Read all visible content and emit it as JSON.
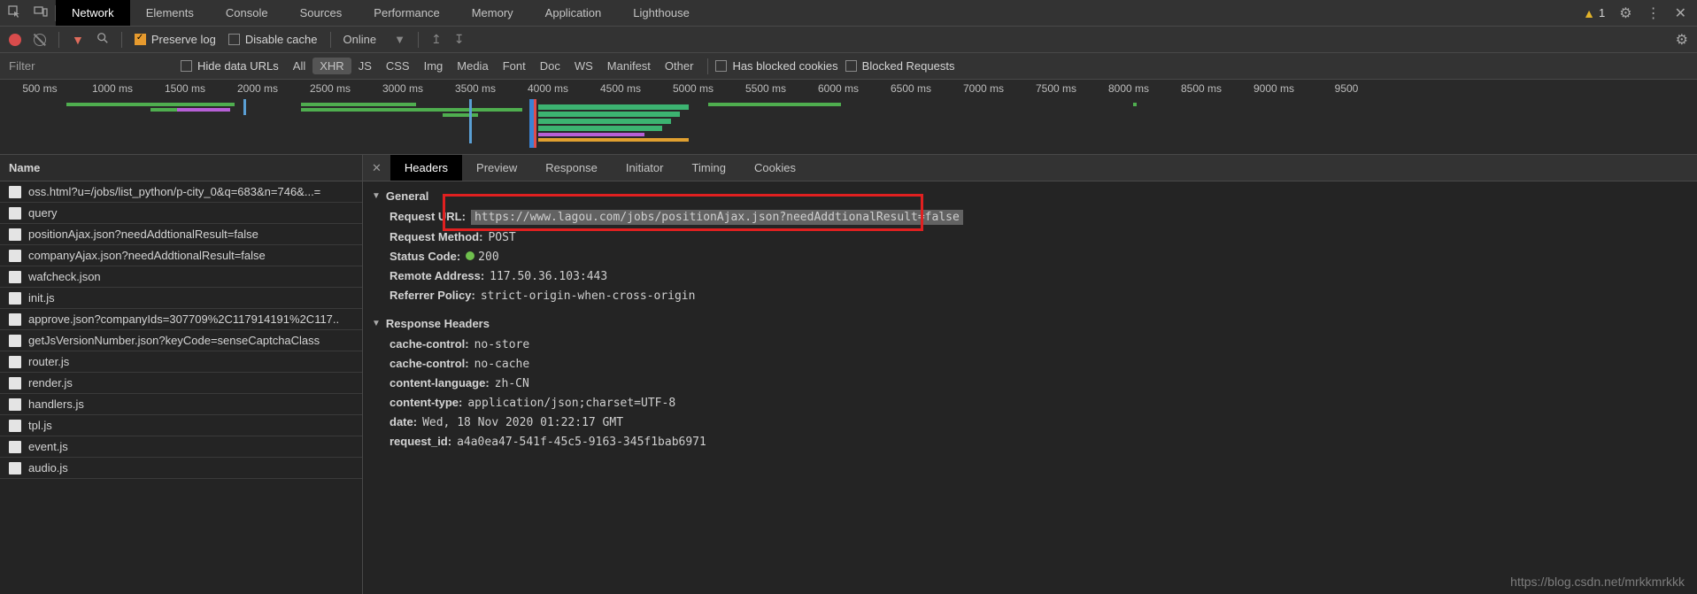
{
  "top_tabs": [
    "Network",
    "Elements",
    "Console",
    "Sources",
    "Performance",
    "Memory",
    "Application",
    "Lighthouse"
  ],
  "top_active": "Network",
  "warning_count": "1",
  "toolbar": {
    "preserve_log": "Preserve log",
    "disable_cache": "Disable cache",
    "online": "Online"
  },
  "filter": {
    "placeholder": "Filter",
    "hide_data_urls": "Hide data URLs",
    "type_filters": [
      "All",
      "XHR",
      "JS",
      "CSS",
      "Img",
      "Media",
      "Font",
      "Doc",
      "WS",
      "Manifest",
      "Other"
    ],
    "type_active": "XHR",
    "has_blocked": "Has blocked cookies",
    "blocked_requests": "Blocked Requests"
  },
  "timeline_ticks": [
    "500 ms",
    "1000 ms",
    "1500 ms",
    "2000 ms",
    "2500 ms",
    "3000 ms",
    "3500 ms",
    "4000 ms",
    "4500 ms",
    "5000 ms",
    "5500 ms",
    "6000 ms",
    "6500 ms",
    "7000 ms",
    "7500 ms",
    "8000 ms",
    "8500 ms",
    "9000 ms",
    "9500"
  ],
  "req_list_header": "Name",
  "requests": [
    "oss.html?u=/jobs/list_python/p-city_0&q=683&n=746&...=",
    "query",
    "positionAjax.json?needAddtionalResult=false",
    "companyAjax.json?needAddtionalResult=false",
    "wafcheck.json",
    "init.js",
    "approve.json?companyIds=307709%2C117914191%2C117..",
    "getJsVersionNumber.json?keyCode=senseCaptchaClass",
    "router.js",
    "render.js",
    "handlers.js",
    "tpl.js",
    "event.js",
    "audio.js"
  ],
  "detail_tabs": [
    "Headers",
    "Preview",
    "Response",
    "Initiator",
    "Timing",
    "Cookies"
  ],
  "detail_active": "Headers",
  "sections": {
    "general": "General",
    "response_headers": "Response Headers"
  },
  "general": {
    "request_url_label": "Request URL:",
    "request_url": "https://www.lagou.com/jobs/positionAjax.json?needAddtionalResult=false",
    "request_method_label": "Request Method:",
    "request_method": "POST",
    "status_code_label": "Status Code:",
    "status_code": "200",
    "remote_addr_label": "Remote Address:",
    "remote_addr": "117.50.36.103:443",
    "referrer_label": "Referrer Policy:",
    "referrer": "strict-origin-when-cross-origin"
  },
  "response_headers": [
    {
      "k": "cache-control:",
      "v": "no-store"
    },
    {
      "k": "cache-control:",
      "v": "no-cache"
    },
    {
      "k": "content-language:",
      "v": "zh-CN"
    },
    {
      "k": "content-type:",
      "v": "application/json;charset=UTF-8"
    },
    {
      "k": "date:",
      "v": "Wed, 18 Nov 2020 01:22:17 GMT"
    },
    {
      "k": "request_id:",
      "v": "a4a0ea47-541f-45c5-9163-345f1bab6971"
    }
  ],
  "watermark": "https://blog.csdn.net/mrkkmrkkk"
}
